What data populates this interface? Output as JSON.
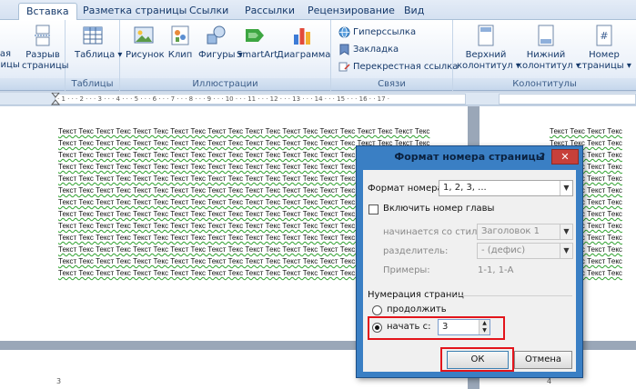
{
  "tabs": [
    "Вставка",
    "Разметка страницы",
    "Ссылки",
    "Рассылки",
    "Рецензирование",
    "Вид"
  ],
  "ribbon": {
    "partial_left": {
      "line1": "тая",
      "line2": "ницы"
    },
    "page_break": {
      "line1": "Разрыв",
      "line2": "страницы"
    },
    "tables": {
      "label": "Таблица",
      "group": "Таблицы"
    },
    "illustrations": {
      "items": [
        "Рисунок",
        "Клип",
        "Фигуры",
        "SmartArt",
        "Диаграмма"
      ],
      "group": "Иллюстрации"
    },
    "links": {
      "items": [
        "Гиперссылка",
        "Закладка",
        "Перекрестная ссылка"
      ],
      "group": "Связи"
    },
    "headers": {
      "header_l1": "Верхний",
      "header_l2": "колонтитул",
      "footer_l1": "Нижний",
      "footer_l2": "колонтитул",
      "pagenum_l1": "Номер",
      "pagenum_l2": "страницы",
      "group": "Колонтитулы"
    }
  },
  "ruler_text": "· 1 · · · 2 · · · 3 · · · 4 · · · 5 · · · 6 · · · 7 · · · 8 · · · 9 · · · 10 · · · 11 · · · 12 · · · 13 · · · 14 · · · 15 · · · 16 · · 17 ·",
  "document": {
    "line": "Текст Текс Текст Текс Текст Текс Текст Текс Текст Текс Текст Текс Текст Текс Текст Текс Текст Текс Текст Текс",
    "page2_line": "Текст Текс Текст Текс",
    "page_number_left": "3",
    "page_number_right": "4"
  },
  "dialog": {
    "title": "Формат номера страницы",
    "help": "?",
    "close": "✕",
    "number_format_label": "Формат номера:",
    "number_format_value": "1, 2, 3, ...",
    "include_chapter_label": "Включить номер главы",
    "chapter_style_label": "начинается со стиля:",
    "chapter_style_value": "Заголовок 1",
    "separator_label": "разделитель:",
    "separator_value": "-   (дефис)",
    "examples_label": "Примеры:",
    "examples_value": "1-1, 1-А",
    "numbering_label": "Нумерация страниц",
    "continue_label": "продолжить",
    "start_at_label": "начать с:",
    "start_at_value": "3",
    "ok": "ОК",
    "cancel": "Отмена"
  }
}
